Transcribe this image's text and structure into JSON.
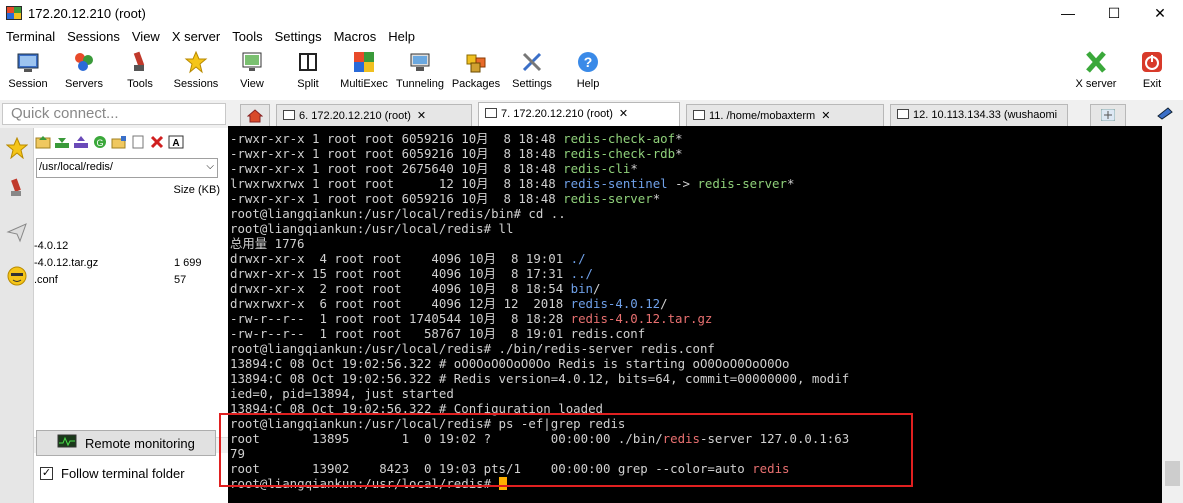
{
  "window": {
    "title": "172.20.12.210 (root)",
    "minimize": "—",
    "maximize": "☐",
    "close": "✕"
  },
  "menu": [
    "Terminal",
    "Sessions",
    "View",
    "X server",
    "Tools",
    "Settings",
    "Macros",
    "Help"
  ],
  "toolbar": {
    "left": [
      {
        "label": "Session",
        "icon": "session-icon"
      },
      {
        "label": "Servers",
        "icon": "servers-icon"
      },
      {
        "label": "Tools",
        "icon": "tools-icon"
      },
      {
        "label": "Sessions",
        "icon": "star-icon"
      },
      {
        "label": "View",
        "icon": "view-icon"
      },
      {
        "label": "Split",
        "icon": "split-icon"
      },
      {
        "label": "MultiExec",
        "icon": "multiexec-icon"
      },
      {
        "label": "Tunneling",
        "icon": "tunneling-icon"
      },
      {
        "label": "Packages",
        "icon": "packages-icon"
      },
      {
        "label": "Settings",
        "icon": "settings-icon"
      },
      {
        "label": "Help",
        "icon": "help-icon"
      }
    ],
    "right": [
      {
        "label": "X server",
        "icon": "x-server-icon"
      },
      {
        "label": "Exit",
        "icon": "exit-icon"
      }
    ]
  },
  "left_panel": {
    "quick_connect_placeholder": "Quick connect...",
    "path": "/usr/local/redis/",
    "size_header": "Size (KB)",
    "files": [
      {
        "name": "-4.0.12",
        "size": ""
      },
      {
        "name": "-4.0.12.tar.gz",
        "size": "1 699"
      },
      {
        "name": ".conf",
        "size": "57"
      }
    ],
    "remote_monitoring": "Remote monitoring",
    "follow_terminal_folder": "Follow terminal folder",
    "follow_checked": "✓"
  },
  "tabs": [
    {
      "label": "6. 172.20.12.210 (root)",
      "active": false
    },
    {
      "label": "7. 172.20.12.210 (root)",
      "active": true
    },
    {
      "label": "11. /home/mobaxterm",
      "active": false
    },
    {
      "label": "12. 10.113.134.33 (wushaomi",
      "active": false
    }
  ],
  "tab_close": "✕",
  "terminal": {
    "colors": {
      "green": "#8fd07a",
      "blue": "#6fa0e8",
      "red": "#e87070",
      "cursor": "#ffb000"
    },
    "lines": [
      [
        {
          "t": "-rwxr-xr-x 1 root root 6059216 10月  8 18:48 "
        },
        {
          "t": "redis-check-aof",
          "c": "green"
        },
        {
          "t": "*"
        }
      ],
      [
        {
          "t": "-rwxr-xr-x 1 root root 6059216 10月  8 18:48 "
        },
        {
          "t": "redis-check-rdb",
          "c": "green"
        },
        {
          "t": "*"
        }
      ],
      [
        {
          "t": "-rwxr-xr-x 1 root root 2675640 10月  8 18:48 "
        },
        {
          "t": "redis-cli",
          "c": "green"
        },
        {
          "t": "*"
        }
      ],
      [
        {
          "t": "lrwxrwxrwx 1 root root      12 10月  8 18:48 "
        },
        {
          "t": "redis-sentinel",
          "c": "blue"
        },
        {
          "t": " -> "
        },
        {
          "t": "redis-server",
          "c": "green"
        },
        {
          "t": "*"
        }
      ],
      [
        {
          "t": "-rwxr-xr-x 1 root root 6059216 10月  8 18:48 "
        },
        {
          "t": "redis-server",
          "c": "green"
        },
        {
          "t": "*"
        }
      ],
      [
        {
          "t": "root@liangqiankun:/usr/local/redis/bin# cd .."
        }
      ],
      [
        {
          "t": "root@liangqiankun:/usr/local/redis# ll"
        }
      ],
      [
        {
          "t": "总用量 1776"
        }
      ],
      [
        {
          "t": "drwxr-xr-x  4 root root    4096 10月  8 19:01 "
        },
        {
          "t": "./",
          "c": "blue"
        }
      ],
      [
        {
          "t": "drwxr-xr-x 15 root root    4096 10月  8 17:31 "
        },
        {
          "t": "../",
          "c": "blue"
        }
      ],
      [
        {
          "t": "drwxr-xr-x  2 root root    4096 10月  8 18:54 "
        },
        {
          "t": "bin",
          "c": "blue"
        },
        {
          "t": "/"
        }
      ],
      [
        {
          "t": "drwxrwxr-x  6 root root    4096 12月 12  2018 "
        },
        {
          "t": "redis-4.0.12",
          "c": "blue"
        },
        {
          "t": "/"
        }
      ],
      [
        {
          "t": "-rw-r--r--  1 root root 1740544 10月  8 18:28 "
        },
        {
          "t": "redis-4.0.12.tar.gz",
          "c": "red"
        }
      ],
      [
        {
          "t": "-rw-r--r--  1 root root   58767 10月  8 19:01 redis.conf"
        }
      ],
      [
        {
          "t": "root@liangqiankun:/usr/local/redis# ./bin/redis-server redis.conf"
        }
      ],
      [
        {
          "t": "13894:C 08 Oct 19:02:56.322 # oO0OoO0OoO0Oo Redis is starting oO0OoO0OoO0Oo"
        }
      ],
      [
        {
          "t": "13894:C 08 Oct 19:02:56.322 # Redis version=4.0.12, bits=64, commit=00000000, modif"
        }
      ],
      [
        {
          "t": "ied=0, pid=13894, just started"
        }
      ],
      [
        {
          "t": "13894:C 08 Oct 19:02:56.322 # Configuration loaded"
        }
      ],
      [
        {
          "t": "root@liangqiankun:/usr/local/redis# ps -ef|grep redis"
        }
      ],
      [
        {
          "t": "root       13895       1  0 19:02 ?        00:00:00 ./bin/"
        },
        {
          "t": "redis",
          "c": "red"
        },
        {
          "t": "-server 127.0.0.1:63"
        }
      ],
      [
        {
          "t": "79"
        }
      ],
      [
        {
          "t": "root       13902    8423  0 19:03 pts/1    00:00:00 grep --color=auto "
        },
        {
          "t": "redis",
          "c": "red"
        }
      ],
      [
        {
          "t": "root@liangqiankun:/usr/local/redis# "
        },
        {
          "cursor": true
        }
      ]
    ]
  }
}
